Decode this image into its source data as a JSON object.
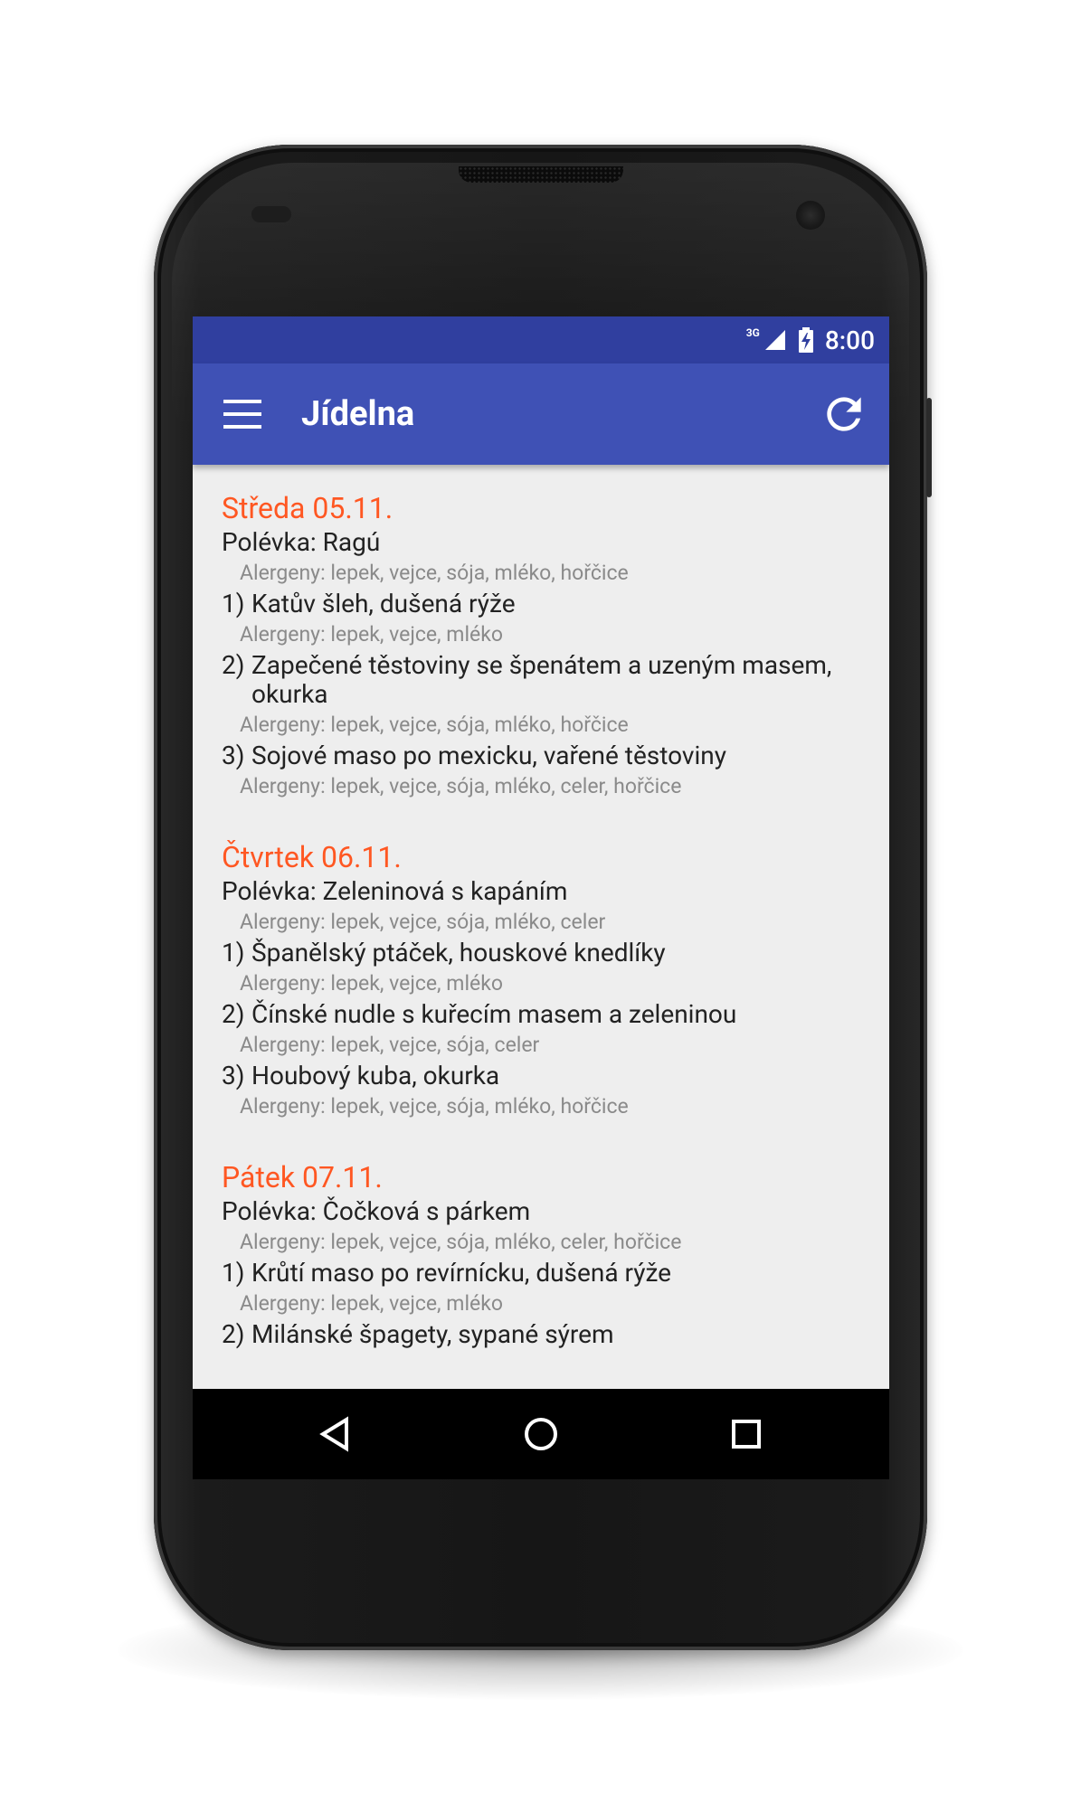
{
  "status_bar": {
    "network_type": "3G",
    "time": "8:00"
  },
  "app_bar": {
    "title": "Jídelna",
    "menu_icon": "menu-icon",
    "refresh_icon": "refresh-icon"
  },
  "days": [
    {
      "title": "Středa 05.11.",
      "soup": "Polévka: Ragú",
      "soup_allergens": "Alergeny: lepek, vejce, sója, mléko, hořčice",
      "dishes": [
        {
          "num": "1)",
          "name": "Katův šleh, dušená rýže",
          "allergens": "Alergeny: lepek, vejce, mléko"
        },
        {
          "num": "2)",
          "name": "Zapečené těstoviny se špenátem a uzeným masem, okurka",
          "allergens": "Alergeny: lepek, vejce, sója, mléko, hořčice"
        },
        {
          "num": "3)",
          "name": "Sojové maso po mexicku, vařené těstoviny",
          "allergens": "Alergeny: lepek, vejce, sója, mléko, celer, hořčice"
        }
      ]
    },
    {
      "title": "Čtvrtek 06.11.",
      "soup": "Polévka: Zeleninová s kapáním",
      "soup_allergens": "Alergeny: lepek, vejce, sója, mléko, celer",
      "dishes": [
        {
          "num": "1)",
          "name": "Španělský ptáček, houskové knedlíky",
          "allergens": "Alergeny: lepek, vejce, mléko"
        },
        {
          "num": "2)",
          "name": "Čínské nudle s kuřecím masem a zeleninou",
          "allergens": "Alergeny: lepek, vejce, sója, celer"
        },
        {
          "num": "3)",
          "name": "Houbový kuba, okurka",
          "allergens": "Alergeny: lepek, vejce, sója, mléko, hořčice"
        }
      ]
    },
    {
      "title": "Pátek 07.11.",
      "soup": "Polévka: Čočková s párkem",
      "soup_allergens": "Alergeny: lepek, vejce, sója, mléko, celer, hořčice",
      "dishes": [
        {
          "num": "1)",
          "name": "Krůtí maso po revírnícku, dušená rýže",
          "allergens": "Alergeny: lepek, vejce, mléko"
        },
        {
          "num": "2)",
          "name": "Milánské špagety, sypané sýrem",
          "allergens": ""
        }
      ]
    }
  ],
  "nav_bar": {
    "back_icon": "back-icon",
    "home_icon": "home-icon",
    "recents_icon": "recents-icon"
  },
  "colors": {
    "status_bar": "#303f9f",
    "app_bar": "#3f51b5",
    "day_title": "#ff5722",
    "screen_bg": "#eeeeee"
  }
}
